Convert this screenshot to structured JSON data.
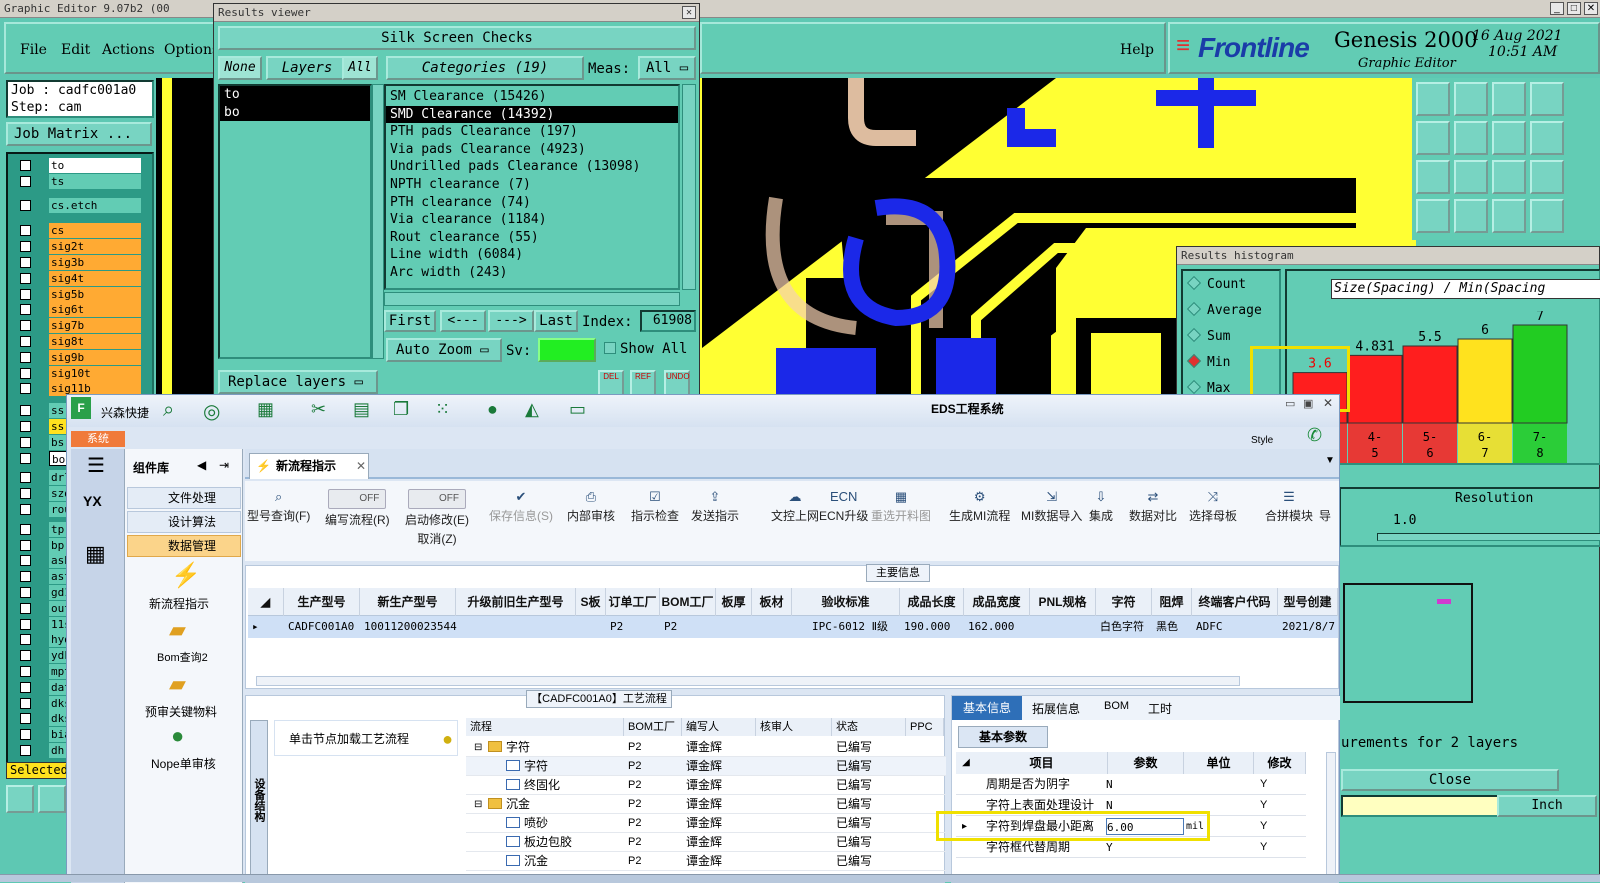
{
  "genesis": {
    "title": "Graphic Editor 9.07b2 (00",
    "menu": [
      "File",
      "Edit",
      "Actions",
      "Options"
    ],
    "help": "Help",
    "brand": "Frontline",
    "product": "Genesis 2000",
    "subtitle": "Graphic Editor",
    "date": "16 Aug 2021",
    "time": "10:51 AM",
    "job": "Job : cadfc001a0",
    "step": "Step: cam",
    "job_matrix": "Job Matrix ...",
    "layers": [
      "to",
      "ts",
      "cs.etch",
      "cs",
      "sig2t",
      "sig3b",
      "sig4t",
      "sig5b",
      "sig6t",
      "sig7b",
      "sig8t",
      "sig9b",
      "sig10t",
      "sig11b",
      "ss.",
      "ss",
      "bs",
      "bo",
      "drl",
      "szd",
      "rou",
      "tp",
      "bp",
      "asb",
      "ast",
      "gd1",
      "out",
      "11s",
      "hyd",
      "ydk",
      "mpt",
      "dat",
      "dks",
      "dks",
      "bia",
      "dh"
    ],
    "selected_label": "Selected"
  },
  "results_viewer": {
    "title": "Results viewer",
    "header": "Silk Screen Checks",
    "none_btn": "None",
    "layers_btn": "Layers",
    "all_btn": "All",
    "layer_list": [
      "to",
      "bo"
    ],
    "categories_label": "Categories (19)",
    "meas_label": "Meas:",
    "meas_value": "All",
    "categories": [
      "SM Clearance (15426)",
      "SMD Clearance (14392)",
      "PTH pads Clearance (197)",
      "Via pads Clearance (4923)",
      "Undrilled pads Clearance (13098)",
      "NPTH clearance (7)",
      "PTH clearance (74)",
      "Via clearance (1184)",
      "Rout clearance (55)",
      "Line width (6084)",
      "Arc width (243)"
    ],
    "first": "First",
    "prev": "<---",
    "next": "--->",
    "last": "Last",
    "index_label": "Index:",
    "index_value": "61908",
    "auto_zoom": "Auto Zoom",
    "sv": "Sv:",
    "show_all": "Show All",
    "replace_layers": "Replace layers",
    "small_btns": [
      "DEL",
      "REF",
      "UNDO"
    ]
  },
  "histogram": {
    "title": "Results histogram",
    "options": [
      "Count",
      "Average",
      "Sum",
      "Min",
      "Max"
    ],
    "selected": "Min",
    "chart_title": "Size(Spacing) / Min(Spacing",
    "bars": [
      {
        "label": "3.6",
        "value": 3.6,
        "bin": "",
        "color": "#ff1e1e"
      },
      {
        "label": "4.831",
        "value": 4.831,
        "bin": "4-5",
        "color": "#ff1e1e"
      },
      {
        "label": "5.5",
        "value": 5.5,
        "bin": "5-6",
        "color": "#ff1e1e"
      },
      {
        "label": "6",
        "value": 6,
        "bin": "6-7",
        "color": "#ffe21e"
      },
      {
        "label": "7",
        "value": 7,
        "bin": "7-8",
        "color": "#22cc22"
      }
    ],
    "resolution_label": "Resolution",
    "resolution_value": "1.0",
    "measurements": "urements for 2 layers",
    "close": "Close",
    "inch": "Inch"
  },
  "eds": {
    "brand": "兴森快捷",
    "title": "EDS工程系统",
    "style": "Style",
    "system_tab": "系统",
    "lib_title": "组件库",
    "lib_items": [
      "文件处理",
      "设计算法",
      "数据管理"
    ],
    "lib_icons": [
      "新流程指示",
      "Bom查询2",
      "预审关键物料",
      "Nope单审核"
    ],
    "doc_tab": "新流程指示",
    "toolbar": [
      "型号查询(F)",
      "编写流程(R)",
      "启动修改(E)",
      "保存信息(S)",
      "内部审核",
      "指示检查",
      "发送指示",
      "文控上网",
      "ECN升级",
      "重选开料图",
      "生成MI流程",
      "MI数据导入",
      "集成",
      "数据对比",
      "选择母板",
      "合拼模块",
      "导"
    ],
    "toolbar_sub": "取消(Z)",
    "off": "OFF",
    "main_info": "主要信息",
    "grid_headers": [
      "生产型号",
      "新生产型号",
      "升级前旧生产型号",
      "S板",
      "订单工厂",
      "BOM工厂",
      "板厚",
      "板材",
      "验收标准",
      "成品长度",
      "成品宽度",
      "PNL规格",
      "字符",
      "阻焊",
      "终端客户代码",
      "型号创建"
    ],
    "grid_row": [
      "CADFC001A0",
      "10011200023544",
      "",
      "",
      "P2",
      "P2",
      "",
      "",
      "IPC-6012 Ⅱ级",
      "190.000",
      "162.000",
      "",
      "白色字符",
      "黑色",
      "ADFC",
      "2021/8/7"
    ],
    "flow_title": "【CADFC001A0】工艺流程",
    "side_label": "设备结构",
    "load_hint": "单击节点加载工艺流程",
    "flow_headers": [
      "流程",
      "BOM工厂",
      "编写人",
      "核审人",
      "状态",
      "PPC"
    ],
    "flow_rows": [
      {
        "name": "字符",
        "indent": 1,
        "folder": true,
        "bom": "P2",
        "author": "谭金辉",
        "state": "已编写"
      },
      {
        "name": "字符",
        "indent": 2,
        "folder": false,
        "bom": "P2",
        "author": "谭金辉",
        "state": "已编写"
      },
      {
        "name": "终固化",
        "indent": 2,
        "folder": false,
        "bom": "P2",
        "author": "谭金辉",
        "state": "已编写"
      },
      {
        "name": "沉金",
        "indent": 1,
        "folder": true,
        "bom": "P2",
        "author": "谭金辉",
        "state": "已编写"
      },
      {
        "name": "喷砂",
        "indent": 2,
        "folder": false,
        "bom": "P2",
        "author": "谭金辉",
        "state": "已编写"
      },
      {
        "name": "板边包胶",
        "indent": 2,
        "folder": false,
        "bom": "P2",
        "author": "谭金辉",
        "state": "已编写"
      },
      {
        "name": "沉金",
        "indent": 2,
        "folder": false,
        "bom": "P2",
        "author": "谭金辉",
        "state": "已编写"
      }
    ],
    "right_tabs": [
      "基本信息",
      "拓展信息",
      "BOM",
      "工时"
    ],
    "basic_params": "基本参数",
    "param_headers": [
      "项目",
      "参数",
      "单位",
      "修改"
    ],
    "param_rows": [
      {
        "item": "周期是否为阴字",
        "val": "N",
        "unit": "",
        "mod": "Y"
      },
      {
        "item": "字符上表面处理设计",
        "val": "N",
        "unit": "",
        "mod": "Y"
      },
      {
        "item": "字符到焊盘最小距离",
        "val": "6.00",
        "unit": "mil",
        "mod": "Y"
      },
      {
        "item": "字符框代替周期",
        "val": "Y",
        "unit": "",
        "mod": "Y"
      }
    ]
  }
}
